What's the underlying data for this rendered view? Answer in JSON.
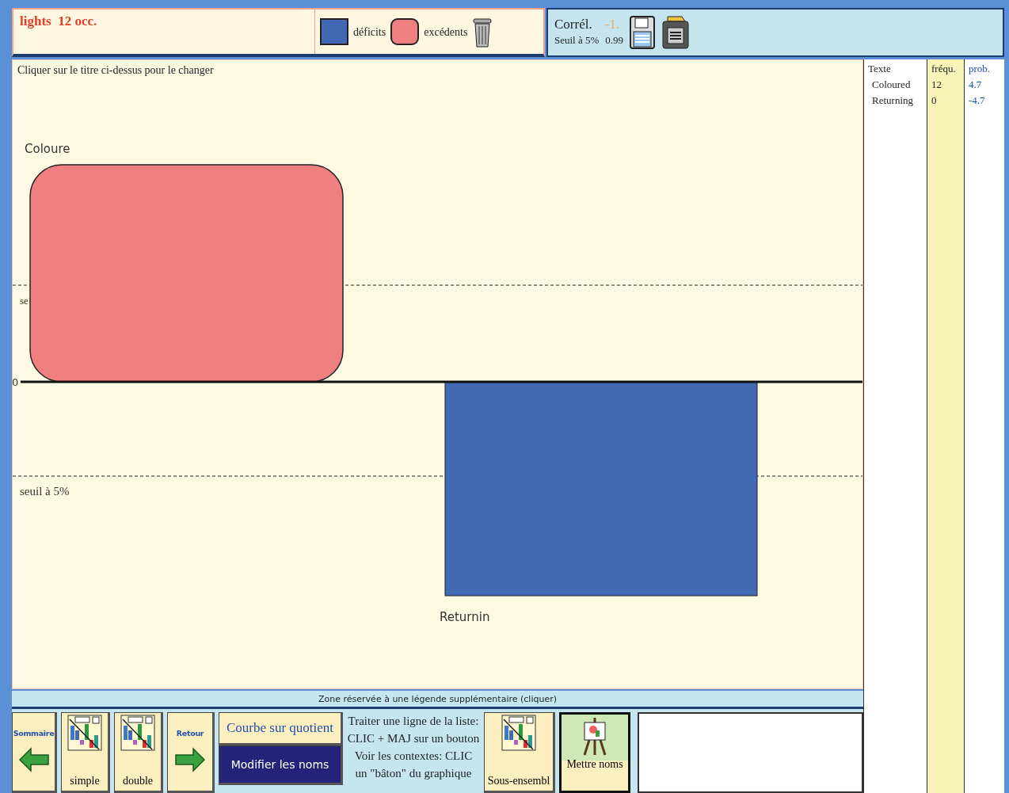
{
  "title": {
    "text": "lights  12 occ."
  },
  "legend": [
    {
      "kind": "deficit",
      "label": "déficits",
      "color": "#4169b4"
    },
    {
      "kind": "excess",
      "label": "excédents",
      "color": "#f07f80"
    }
  ],
  "correlation": {
    "label": "Corrél.",
    "value": "-1.",
    "threshold_label": "Seuil à 5%",
    "threshold_value": "0.99"
  },
  "chart": {
    "hint": "Cliquer sur le titre ci-dessus pour le changer",
    "zero_label": "0",
    "threshold_labels": [
      "se",
      "seuil à 5%"
    ],
    "bars": [
      {
        "label": "Coloure",
        "kind": "excess"
      },
      {
        "label": "Returnin",
        "kind": "deficit"
      }
    ]
  },
  "caption_zone": "Zone réservée à une légende supplémentaire (cliquer)",
  "list": {
    "columns": [
      "Texte",
      "fréqu.",
      "prob."
    ],
    "rows": [
      [
        "Coloured",
        "12",
        "4.7"
      ],
      [
        "Returning",
        "0",
        "-4.7"
      ]
    ]
  },
  "toolbar": [
    {
      "kind": "back",
      "label": "Sommaire"
    },
    {
      "kind": "chart",
      "label": "simple"
    },
    {
      "kind": "chart",
      "label": "double"
    },
    {
      "kind": "forward",
      "label": "Retour"
    },
    {
      "kind": "pair",
      "labels": [
        "Courbe sur quotient",
        "Modifier les noms"
      ]
    },
    {
      "kind": "note",
      "lines": [
        "Traiter une ligne de la liste:",
        "CLIC + MAJ sur un bouton",
        "Voir les contextes: CLIC",
        "un \"bâton\" du graphique"
      ]
    },
    {
      "kind": "chart",
      "label": "Sous-ensembl"
    },
    {
      "kind": "easel",
      "label": "Mettre noms"
    }
  ]
}
